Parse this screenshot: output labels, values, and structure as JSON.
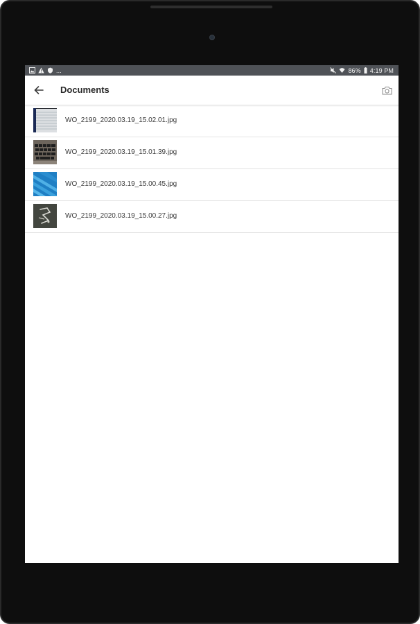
{
  "status_bar": {
    "left_icons": [
      "gallery-notification-icon",
      "warning-notification-icon",
      "shield-notification-icon"
    ],
    "overflow": "...",
    "battery": "86%",
    "time": "4:19 PM",
    "right_icons": [
      "mute-icon",
      "wifi-icon",
      "battery-icon"
    ]
  },
  "app_bar": {
    "title": "Documents",
    "back_icon": "arrow-left-icon",
    "action_icon": "camera-icon"
  },
  "files": [
    {
      "name": "WO_2199_2020.03.19_15.02.01.jpg",
      "thumbnail": "lined-paper-photo"
    },
    {
      "name": "WO_2199_2020.03.19_15.01.39.jpg",
      "thumbnail": "keyboard-photo"
    },
    {
      "name": "WO_2199_2020.03.19_15.00.45.jpg",
      "thumbnail": "blue-waves-photo"
    },
    {
      "name": "WO_2199_2020.03.19_15.00.27.jpg",
      "thumbnail": "dark-sketch-photo"
    }
  ],
  "colors": {
    "status_bar": "#4f5257",
    "bezel": "#0e0e0e",
    "divider": "#e3e3e3",
    "text": "#3a3a3a"
  }
}
